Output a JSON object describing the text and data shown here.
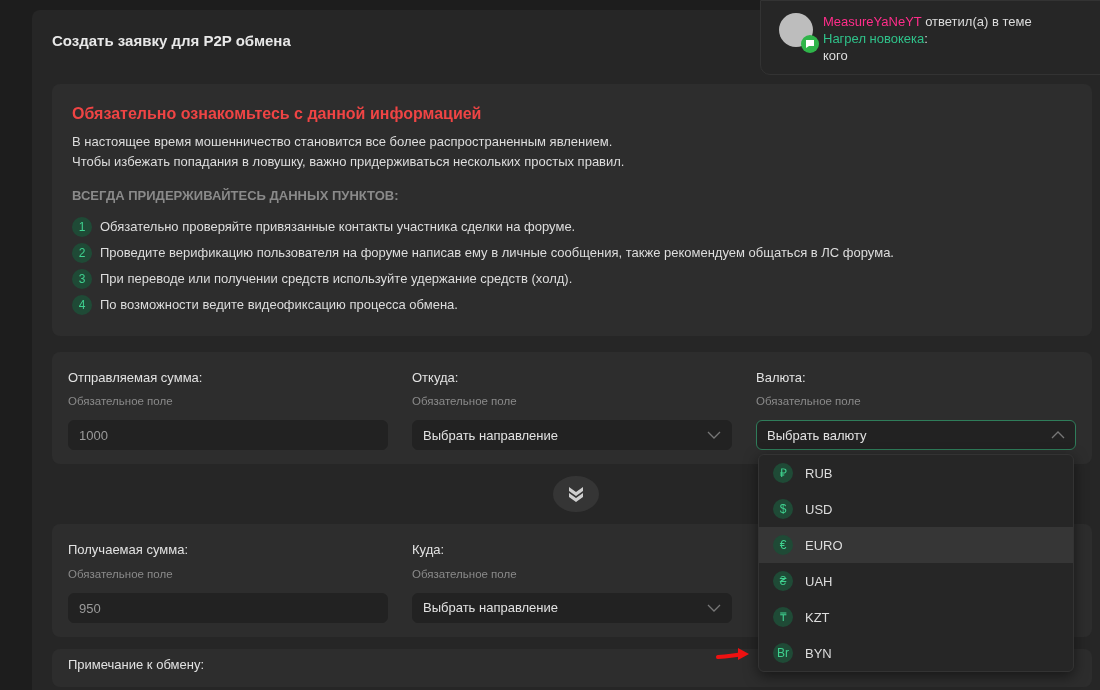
{
  "page": {
    "title": "Создать заявку для P2P обмена"
  },
  "notification": {
    "user": "MeasureYaNeYT",
    "action": " ответил(а) в теме",
    "thread": "Нагрел новокека",
    "colon": ":",
    "message": "кого"
  },
  "info": {
    "heading": "Обязательно ознакомьтесь с данной информацией",
    "lines": [
      "В настоящее время мошенничество становится все более распространенным явлением.",
      "Чтобы избежать попадания в ловушку, важно придерживаться нескольких простых правил."
    ],
    "rules_title": "ВСЕГДА ПРИДЕРЖИВАЙТЕСЬ ДАННЫХ ПУНКТОВ:",
    "rules": [
      {
        "number": "1",
        "text": "Обязательно проверяйте привязанные контакты участника сделки на форуме."
      },
      {
        "number": "2",
        "text": "Проведите верификацию пользователя на форуме написав ему в личные сообщения, также рекомендуем общаться в ЛС форума."
      },
      {
        "number": "3",
        "text": "При переводе или получении средств используйте удержание средств (холд)."
      },
      {
        "number": "4",
        "text": "По возможности ведите видеофиксацию процесса обмена."
      }
    ]
  },
  "send": {
    "fields": [
      {
        "kind": "input",
        "label": "Отправляемая сумма:",
        "hint": "Обязательное поле",
        "value": "1000"
      },
      {
        "kind": "select",
        "label": "Откуда:",
        "hint": "Обязательное поле",
        "value": "Выбрать направление",
        "expanded": false
      },
      {
        "kind": "select",
        "label": "Валюта:",
        "hint": "Обязательное поле",
        "value": "Выбрать валюту",
        "expanded": true
      }
    ]
  },
  "receive": {
    "fields": [
      {
        "kind": "input",
        "label": "Получаемая сумма:",
        "hint": "Обязательное поле",
        "value": "950"
      },
      {
        "kind": "select",
        "label": "Куда:",
        "hint": "Обязательное поле",
        "value": "Выбрать направление",
        "expanded": false
      }
    ]
  },
  "note": {
    "label": "Примечание к обмену:"
  },
  "currency_menu": [
    {
      "symbol": "₽",
      "code": "RUB",
      "selected": false
    },
    {
      "symbol": "$",
      "code": "USD",
      "selected": false
    },
    {
      "symbol": "€",
      "code": "EURO",
      "selected": true
    },
    {
      "symbol": "₴",
      "code": "UAH",
      "selected": false
    },
    {
      "symbol": "₸",
      "code": "KZT",
      "selected": false
    },
    {
      "symbol": "Br",
      "code": "BYN",
      "selected": false
    }
  ]
}
